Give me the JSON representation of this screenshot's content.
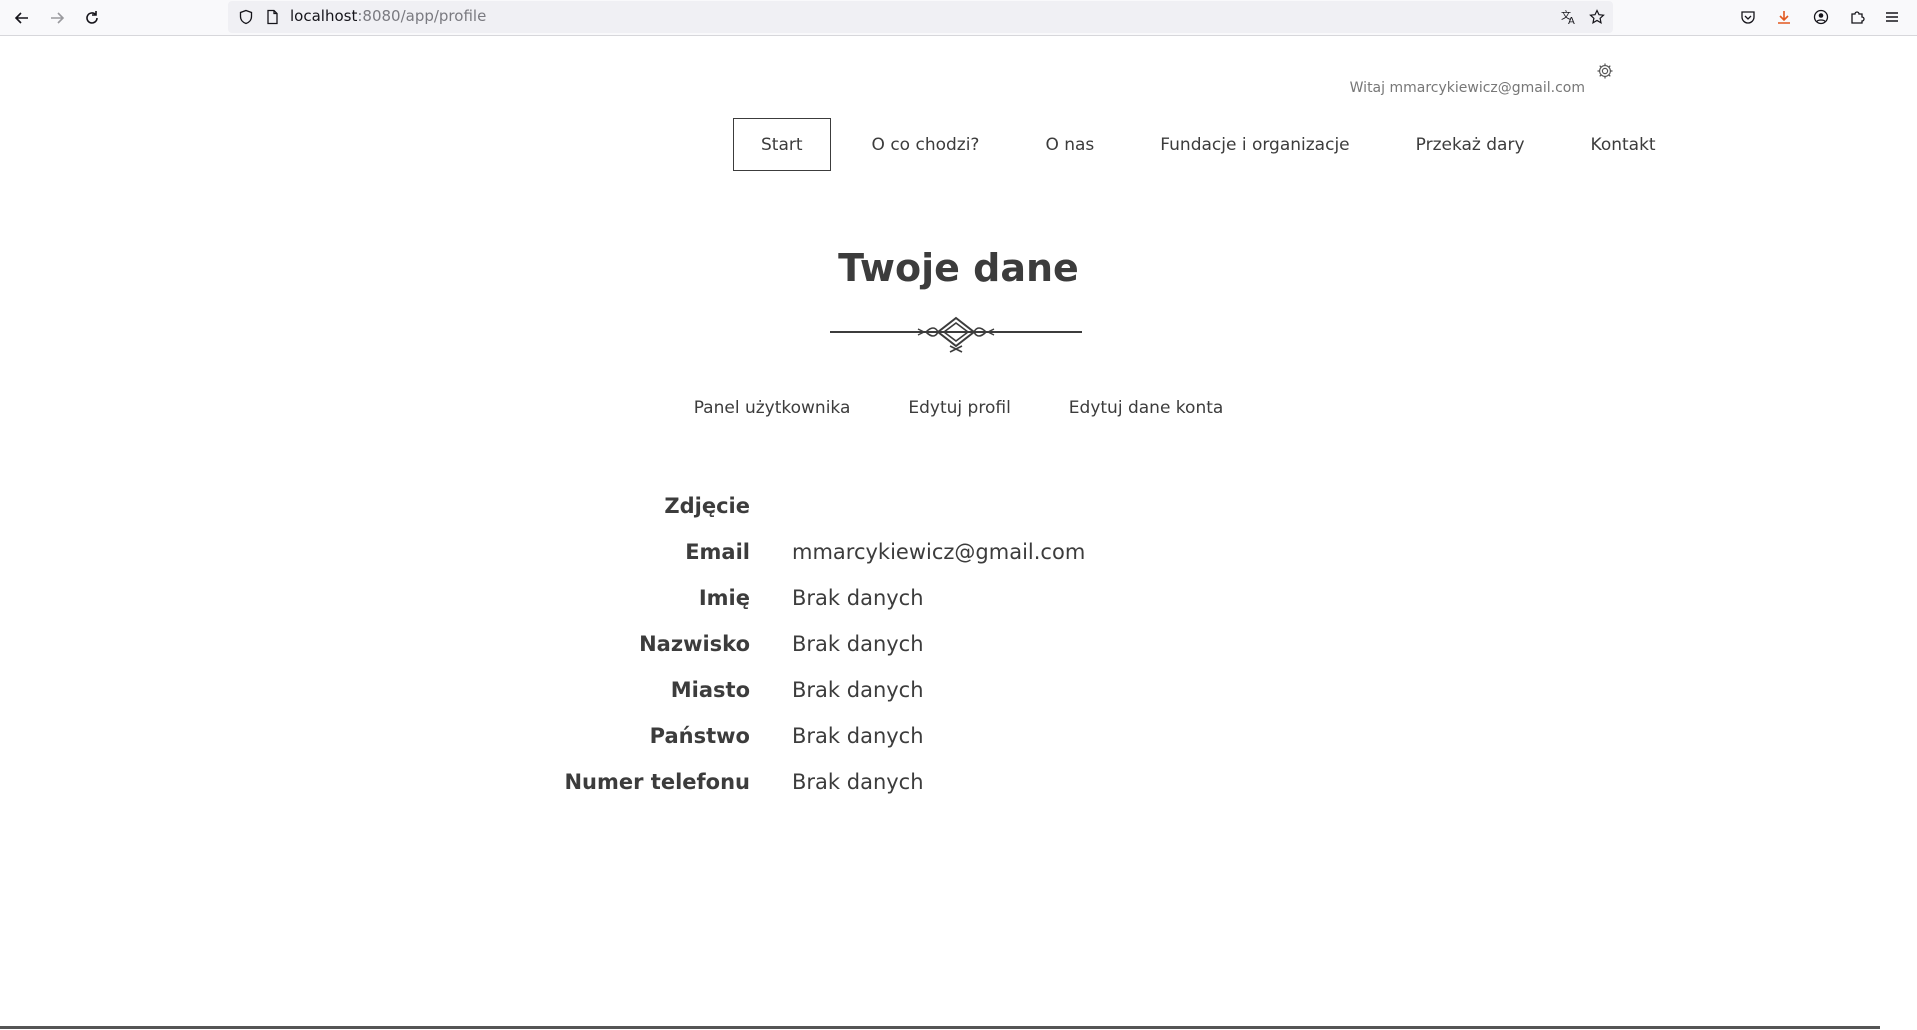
{
  "browser": {
    "url_host": "localhost",
    "url_rest": ":8080/app/profile"
  },
  "header": {
    "greeting": "Witaj mmarcykiewicz@gmail.com"
  },
  "nav": {
    "items": [
      {
        "label": "Start",
        "active": true
      },
      {
        "label": "O co chodzi?"
      },
      {
        "label": "O nas"
      },
      {
        "label": "Fundacje i organizacje"
      },
      {
        "label": "Przekaż dary"
      },
      {
        "label": "Kontakt"
      }
    ]
  },
  "page": {
    "title": "Twoje dane"
  },
  "subnav": {
    "items": [
      {
        "label": "Panel użytkownika"
      },
      {
        "label": "Edytuj profil"
      },
      {
        "label": "Edytuj dane konta"
      }
    ]
  },
  "profile": {
    "rows": [
      {
        "label": "Zdjęcie",
        "value": ""
      },
      {
        "label": "Email",
        "value": "mmarcykiewicz@gmail.com"
      },
      {
        "label": "Imię",
        "value": "Brak danych"
      },
      {
        "label": "Nazwisko",
        "value": "Brak danych"
      },
      {
        "label": "Miasto",
        "value": "Brak danych"
      },
      {
        "label": "Państwo",
        "value": "Brak danych"
      },
      {
        "label": "Numer telefonu",
        "value": "Brak danych"
      }
    ]
  },
  "colors": {
    "text": "#3c3c3c",
    "muted": "#777777",
    "download_accent": "#e25920"
  }
}
